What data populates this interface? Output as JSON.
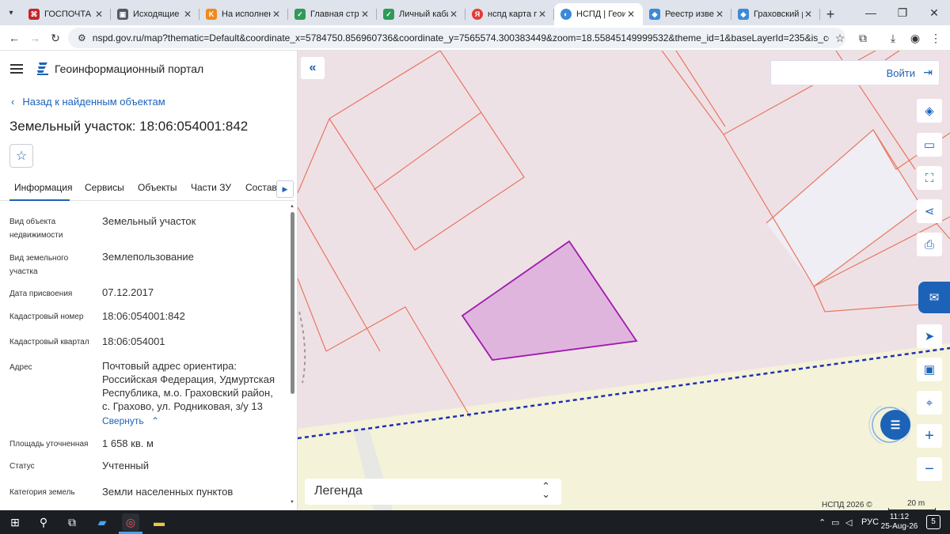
{
  "browser": {
    "tabs": [
      {
        "label": "ГОСПОЧТА",
        "icon_color": "#c1272d",
        "icon": "gosmail-icon"
      },
      {
        "label": "Исходящие",
        "icon_color": "#555a63",
        "icon": "outbox-icon"
      },
      {
        "label": "На исполнени",
        "icon_color": "#f08a1c",
        "icon": "task-icon"
      },
      {
        "label": "Главная стран",
        "icon_color": "#2f9a57",
        "icon": "home-site-icon"
      },
      {
        "label": "Личный кабин",
        "icon_color": "#2f9a57",
        "icon": "cabinet-icon"
      },
      {
        "label": "нспд карта пу",
        "icon_color": "#e53935",
        "icon": "yandex-icon"
      },
      {
        "label": "НСПД | Геоин",
        "icon_color": "#3b8ad9",
        "icon": "nspd-icon",
        "active": true
      },
      {
        "label": "Реестр извещ",
        "icon_color": "#3b8ad9",
        "icon": "registry-icon"
      },
      {
        "label": "Граховский р",
        "icon_color": "#3b8ad9",
        "icon": "district-icon"
      }
    ],
    "url": "nspd.gov.ru/map?thematic=Default&coordinate_x=5784750.856960736&coordinate_y=7565574.300383449&zoom=18.55845149999532&theme_id=1&baseLayerId=235&is_copy_url=true&active_..."
  },
  "panel": {
    "portal_title": "Геоинформационный портал",
    "back_label": "Назад к найденным объектам",
    "object_title": "Земельный участок: 18:06:054001:842",
    "tabs": [
      "Информация",
      "Сервисы",
      "Объекты",
      "Части ЗУ",
      "Состав"
    ],
    "fields": [
      {
        "label": "Вид объекта недвижимости",
        "value": "Земельный участок"
      },
      {
        "label": "Вид земельного участка",
        "value": "Землепользование"
      },
      {
        "label": "Дата присвоения",
        "value": "07.12.2017"
      },
      {
        "label": "Кадастровый номер",
        "value": "18:06:054001:842"
      },
      {
        "label": "Кадастровый квартал",
        "value": "18:06:054001"
      },
      {
        "label": "Адрес",
        "value": "Почтовый адрес ориентира: Российская Федерация, Удмуртская Республика, м.о. Граховский район, с. Грахово, ул. Родниковая, з/у 13"
      },
      {
        "label": "Площадь уточненная",
        "value": "1 658 кв. м"
      },
      {
        "label": "Статус",
        "value": "Учтенный"
      },
      {
        "label": "Категория земель",
        "value": "Земли населенных пунктов"
      }
    ],
    "collapse_label": "Свернуть"
  },
  "map": {
    "login_label": "Войти",
    "legend_label": "Легенда",
    "copyright": "НСПД 2026 ©",
    "scale_label": "20 m",
    "colors": {
      "parcel_fill": "#eee1e6",
      "parcel_line": "#e8775f",
      "selected_fill": "#dfb5dd",
      "selected_line": "#a01aad",
      "boundary": "#1f2fb5",
      "field": "#f4f2d8",
      "accent": "#1c63b8"
    },
    "tools": [
      "layers-icon",
      "ruler-icon",
      "select-area-icon",
      "share-icon",
      "print-icon",
      "locate-icon",
      "minimap-icon",
      "geo-search-icon",
      "zoom-in-icon",
      "zoom-out-icon"
    ]
  },
  "taskbar": {
    "lang": "РУС",
    "time": "11:12",
    "date": "25-Aug-26",
    "notifications": "5"
  }
}
